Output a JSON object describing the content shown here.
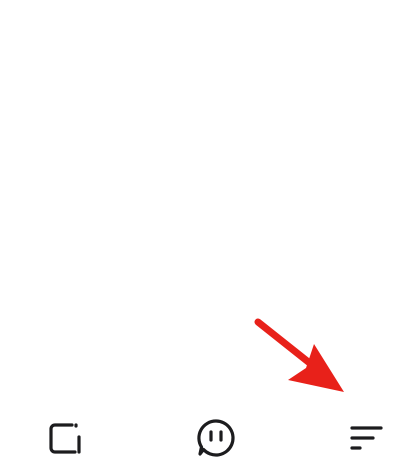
{
  "bottom_nav": {
    "items": [
      {
        "icon": "panel-icon"
      },
      {
        "icon": "chat-bubble-icon"
      },
      {
        "icon": "sort-menu-icon"
      }
    ]
  },
  "annotation": {
    "color": "#e8211a",
    "points_to": "sort-menu-icon"
  }
}
